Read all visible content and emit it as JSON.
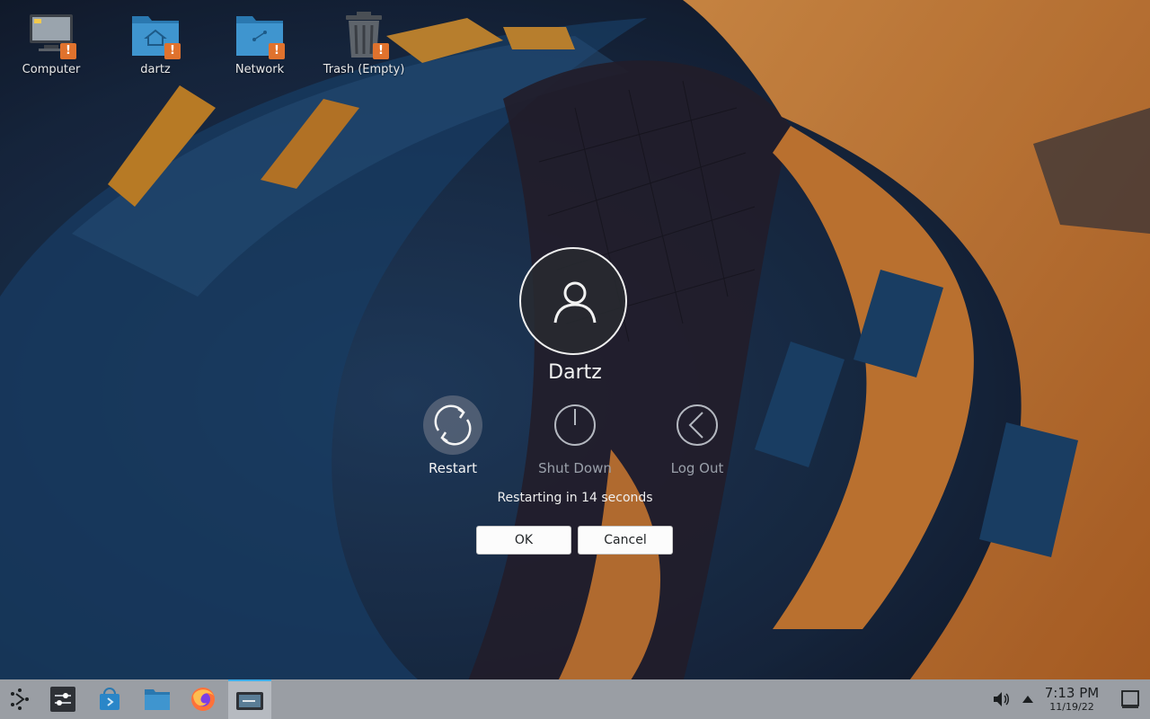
{
  "desktop": {
    "icons": [
      {
        "label": "Computer",
        "icon": "computer-icon"
      },
      {
        "label": "dartz",
        "icon": "home-folder-icon"
      },
      {
        "label": "Network",
        "icon": "network-folder-icon"
      },
      {
        "label": "Trash (Empty)",
        "icon": "trash-icon"
      }
    ],
    "warning_glyph": "!"
  },
  "dialog": {
    "username": "Dartz",
    "actions": [
      {
        "label": "Restart",
        "icon": "restart-icon",
        "selected": true
      },
      {
        "label": "Shut Down",
        "icon": "power-icon",
        "selected": false
      },
      {
        "label": "Log Out",
        "icon": "logout-icon",
        "selected": false
      }
    ],
    "countdown": "Restarting in 14 seconds",
    "ok_label": "OK",
    "cancel_label": "Cancel"
  },
  "taskbar": {
    "launchers": [
      "app-menu-icon",
      "system-settings-icon",
      "discover-icon",
      "file-manager-icon",
      "firefox-icon",
      "konsole-icon"
    ],
    "tray": [
      "volume-icon",
      "tray-expand-icon",
      "show-desktop-icon"
    ],
    "clock_time": "7:13 PM",
    "clock_date": "11/19/22"
  },
  "colors": {
    "accent": "#3daee9",
    "warning": "#e0722d",
    "wallpaper_orange": "#e2893a",
    "wallpaper_blue": "#1f4b78",
    "taskbar": "#9a9ea4"
  }
}
